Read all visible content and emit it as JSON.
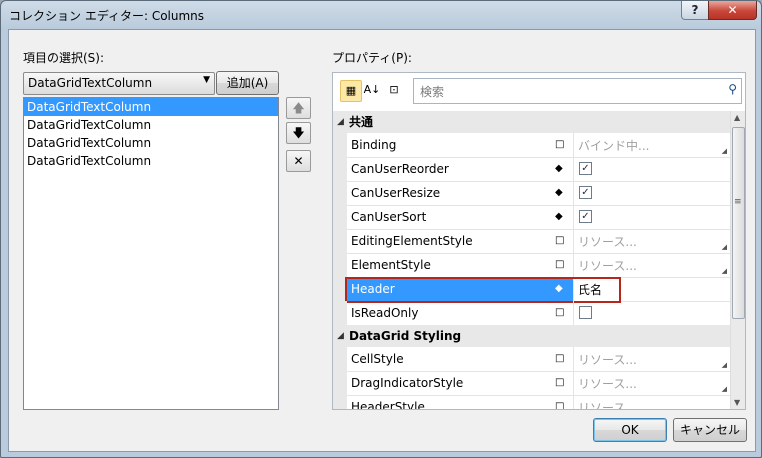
{
  "window": {
    "title": "コレクション エディター: Columns",
    "help": "?",
    "close": "✕"
  },
  "left": {
    "label": "項目の選択(S):",
    "combo_value": "DataGridTextColumn",
    "add_button": "追加(A)",
    "items": [
      "DataGridTextColumn",
      "DataGridTextColumn",
      "DataGridTextColumn",
      "DataGridTextColumn"
    ],
    "selected_index": 0
  },
  "side_buttons": {
    "up": "🡅",
    "down": "🡇",
    "remove": "✕"
  },
  "props": {
    "label": "プロパティ(P):",
    "search_placeholder": "検索",
    "categories": [
      {
        "name": "共通",
        "rows": [
          {
            "name": "Binding",
            "marker": "□",
            "value": "バインド中...",
            "kind": "text"
          },
          {
            "name": "CanUserReorder",
            "marker": "◆",
            "checked": true,
            "kind": "check"
          },
          {
            "name": "CanUserResize",
            "marker": "◆",
            "checked": true,
            "kind": "check"
          },
          {
            "name": "CanUserSort",
            "marker": "◆",
            "checked": true,
            "kind": "check"
          },
          {
            "name": "EditingElementStyle",
            "marker": "□",
            "value": "リソース...",
            "kind": "text"
          },
          {
            "name": "ElementStyle",
            "marker": "□",
            "value": "リソース...",
            "kind": "text"
          },
          {
            "name": "Header",
            "marker": "◆",
            "value": "氏名",
            "kind": "text",
            "selected": true
          },
          {
            "name": "IsReadOnly",
            "marker": "□",
            "checked": false,
            "kind": "check"
          }
        ]
      },
      {
        "name": "DataGrid Styling",
        "rows": [
          {
            "name": "CellStyle",
            "marker": "□",
            "value": "リソース...",
            "kind": "text"
          },
          {
            "name": "DragIndicatorStyle",
            "marker": "□",
            "value": "リソース...",
            "kind": "text"
          },
          {
            "name": "HeaderStyle",
            "marker": "□",
            "value": "リソース...",
            "kind": "text"
          }
        ]
      }
    ]
  },
  "footer": {
    "ok": "OK",
    "cancel": "キャンセル"
  }
}
